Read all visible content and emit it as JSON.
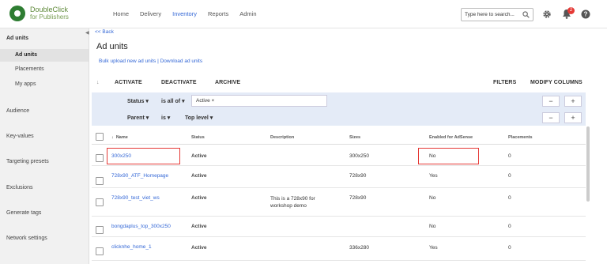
{
  "brand": {
    "line1": "DoubleClick",
    "line2": "for Publishers"
  },
  "nav": [
    "Home",
    "Delivery",
    "Inventory",
    "Reports",
    "Admin"
  ],
  "nav_active": "Inventory",
  "search": {
    "value": "Type here to search..."
  },
  "notifications": {
    "count": "2"
  },
  "sidebar": {
    "items": [
      {
        "label": "Ad units",
        "kind": "section"
      },
      {
        "label": "Ad units",
        "kind": "sub-selected"
      },
      {
        "label": "Placements",
        "kind": "sub"
      },
      {
        "label": "My apps",
        "kind": "sub"
      },
      {
        "label": "Audience",
        "kind": "plain"
      },
      {
        "label": "Key-values",
        "kind": "plain"
      },
      {
        "label": "Targeting presets",
        "kind": "plain"
      },
      {
        "label": "Exclusions",
        "kind": "plain"
      },
      {
        "label": "Generate tags",
        "kind": "plain"
      },
      {
        "label": "Network settings",
        "kind": "plain"
      }
    ]
  },
  "main": {
    "back": "<< Back",
    "title": "Ad units",
    "bulk_upload": "Bulk upload new ad units",
    "separator": "|",
    "download": "Download ad units"
  },
  "toolbar": {
    "activate": "ACTIVATE",
    "deactivate": "DEACTIVATE",
    "archive": "ARCHIVE",
    "filters": "FILTERS",
    "modify_columns": "MODIFY COLUMNS"
  },
  "filters": {
    "row1": {
      "field": "Status",
      "op": "is all of",
      "chip": "Active"
    },
    "row2": {
      "field": "Parent",
      "op": "is",
      "value": "Top level"
    },
    "minus": "−",
    "plus": "+"
  },
  "table": {
    "headers": {
      "name": "Name",
      "status": "Status",
      "description": "Description",
      "sizes": "Sizes",
      "adsense": "Enabled for AdSense",
      "placements": "Placements"
    },
    "rows": [
      {
        "name": "300x250",
        "status": "Active",
        "description": "",
        "sizes": "300x250",
        "adsense": "No",
        "placements": "0"
      },
      {
        "name": "728x90_ATF_Homepage",
        "status": "Active",
        "description": "",
        "sizes": "728x90",
        "adsense": "Yes",
        "placements": "0"
      },
      {
        "name": "728x90_test_viet_ws",
        "status": "Active",
        "description": "This is a 728x90 for workshop demo",
        "sizes": "728x90",
        "adsense": "No",
        "placements": "0"
      },
      {
        "name": "bongdaplus_top_300x250",
        "status": "Active",
        "description": "",
        "sizes": "",
        "adsense": "No",
        "placements": "0"
      },
      {
        "name": "clicknhe_home_1",
        "status": "Active",
        "description": "",
        "sizes": "336x280",
        "adsense": "Yes",
        "placements": "0"
      }
    ]
  },
  "colors": {
    "accent": "#3367d6",
    "highlight": "#e53935",
    "filter_bg": "#e4ebf7"
  }
}
